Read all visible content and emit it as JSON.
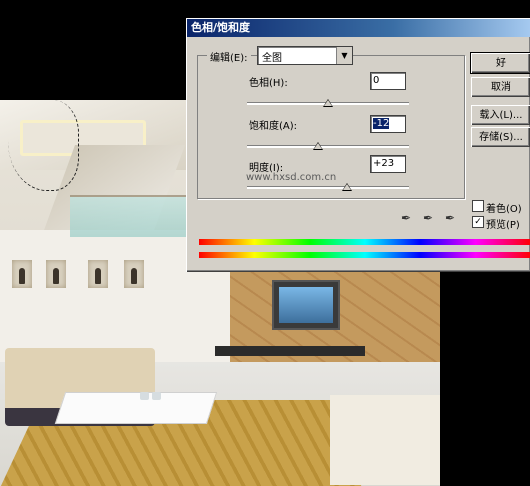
{
  "dialog": {
    "title": "色相/饱和度",
    "edit_label": "编辑(E):",
    "edit_value": "全图",
    "hue_label": "色相(H):",
    "hue_value": "0",
    "saturation_label": "饱和度(A):",
    "saturation_value": "-12",
    "lightness_label": "明度(I):",
    "lightness_value": "+23",
    "watermark": "www.hxsd.com.cn",
    "buttons": {
      "ok": "好",
      "cancel": "取消",
      "load": "载入(L)...",
      "save": "存储(S)..."
    },
    "colorize_label": "着色(O)",
    "preview_label": "预览(P)",
    "colorize_checked": false,
    "preview_checked": true,
    "slider_levels": {
      "hue": 0,
      "saturation": -12,
      "lightness": 23
    }
  },
  "icons": [
    "eyedropper-icon",
    "eyedropper-plus-icon",
    "eyedropper-minus-icon"
  ]
}
